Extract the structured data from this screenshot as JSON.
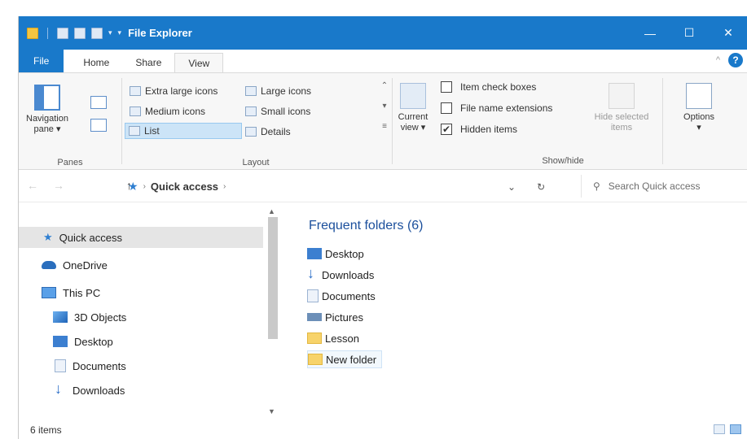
{
  "window": {
    "title": "File Explorer",
    "controls": [
      "—",
      "☐",
      "✕"
    ]
  },
  "qat": {
    "caret": "▾",
    "pin": "▾"
  },
  "tabs": [
    "File",
    "Home",
    "Share",
    "View"
  ],
  "tabs_right": {
    "collapse": "^",
    "help": "?"
  },
  "ribbon": {
    "panes": {
      "label": "Panes",
      "navigation_pane": "Navigation\npane ▾"
    },
    "layout": {
      "label": "Layout",
      "items": [
        "Extra large icons",
        "Large icons",
        "Medium icons",
        "Small icons",
        "List",
        "Details"
      ],
      "selected": "List",
      "scroll": [
        "⌃",
        "▾",
        "≡"
      ]
    },
    "current_view": {
      "label": "Current\nview ▾"
    },
    "show_hide": {
      "label": "Show/hide",
      "item_check_boxes": {
        "label": "Item check boxes",
        "checked": false
      },
      "file_name_extensions": {
        "label": "File name extensions",
        "checked": false
      },
      "hidden_items": {
        "label": "Hidden items",
        "checked": true
      },
      "hide_selected": "Hide selected\nitems",
      "options": "Options\n▾"
    }
  },
  "address": {
    "back": "←",
    "forward": "→",
    "up": "↑",
    "crumb_sep": "›",
    "location": "Quick access",
    "dropdown": "⌄",
    "refresh": "↻",
    "search_icon": "⚲",
    "search_placeholder": "Search Quick access"
  },
  "nav": {
    "items": [
      {
        "label": "Quick access"
      },
      {
        "label": "OneDrive"
      },
      {
        "label": "This PC"
      },
      {
        "label": "3D Objects"
      },
      {
        "label": "Desktop"
      },
      {
        "label": "Documents"
      },
      {
        "label": "Downloads"
      }
    ],
    "scroll_up": "▲",
    "scroll_down": "▼"
  },
  "content": {
    "section_title": "Frequent folders (6)",
    "folders": [
      "Desktop",
      "Downloads",
      "Documents",
      "Pictures",
      "Lesson",
      "New folder"
    ]
  },
  "status": {
    "items": "6 items"
  },
  "colors": {
    "titlebar": "#1979ca",
    "accent": "#1b4f9c",
    "selection": "#cce4f7"
  }
}
